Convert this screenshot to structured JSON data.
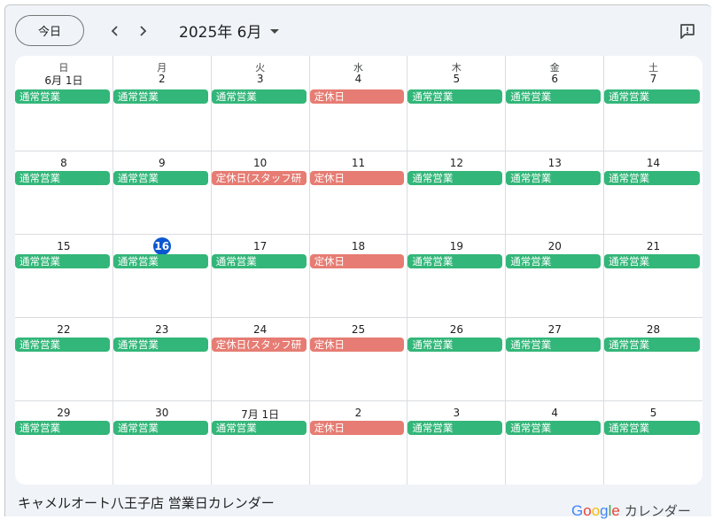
{
  "toolbar": {
    "today_label": "今日",
    "month_title": "2025年 6月",
    "prev_icon": "chevron-left-icon",
    "next_icon": "chevron-right-icon",
    "dropdown_icon": "arrow-drop-down-icon",
    "feedback_icon": "feedback-icon"
  },
  "weekdays": [
    "日",
    "月",
    "火",
    "水",
    "木",
    "金",
    "土"
  ],
  "event_colors": {
    "open": "#33b679",
    "closed": "#e67c73"
  },
  "weeks": [
    [
      {
        "date": "6月 1日",
        "event": "通常営業",
        "type": "open"
      },
      {
        "date": "2",
        "event": "通常営業",
        "type": "open"
      },
      {
        "date": "3",
        "event": "通常営業",
        "type": "open"
      },
      {
        "date": "4",
        "event": "定休日",
        "type": "closed"
      },
      {
        "date": "5",
        "event": "通常営業",
        "type": "open"
      },
      {
        "date": "6",
        "event": "通常営業",
        "type": "open"
      },
      {
        "date": "7",
        "event": "通常営業",
        "type": "open"
      }
    ],
    [
      {
        "date": "8",
        "event": "通常営業",
        "type": "open"
      },
      {
        "date": "9",
        "event": "通常営業",
        "type": "open"
      },
      {
        "date": "10",
        "event": "定休日(スタッフ研",
        "type": "closed"
      },
      {
        "date": "11",
        "event": "定休日",
        "type": "closed"
      },
      {
        "date": "12",
        "event": "通常営業",
        "type": "open"
      },
      {
        "date": "13",
        "event": "通常営業",
        "type": "open"
      },
      {
        "date": "14",
        "event": "通常営業",
        "type": "open"
      }
    ],
    [
      {
        "date": "15",
        "event": "通常営業",
        "type": "open"
      },
      {
        "date": "16",
        "event": "通常営業",
        "type": "open",
        "today": true
      },
      {
        "date": "17",
        "event": "通常営業",
        "type": "open"
      },
      {
        "date": "18",
        "event": "定休日",
        "type": "closed"
      },
      {
        "date": "19",
        "event": "通常営業",
        "type": "open"
      },
      {
        "date": "20",
        "event": "通常営業",
        "type": "open"
      },
      {
        "date": "21",
        "event": "通常営業",
        "type": "open"
      }
    ],
    [
      {
        "date": "22",
        "event": "通常営業",
        "type": "open"
      },
      {
        "date": "23",
        "event": "通常営業",
        "type": "open"
      },
      {
        "date": "24",
        "event": "定休日(スタッフ研",
        "type": "closed"
      },
      {
        "date": "25",
        "event": "定休日",
        "type": "closed"
      },
      {
        "date": "26",
        "event": "通常営業",
        "type": "open"
      },
      {
        "date": "27",
        "event": "通常営業",
        "type": "open"
      },
      {
        "date": "28",
        "event": "通常営業",
        "type": "open"
      }
    ],
    [
      {
        "date": "29",
        "event": "通常営業",
        "type": "open"
      },
      {
        "date": "30",
        "event": "通常営業",
        "type": "open"
      },
      {
        "date": "7月 1日",
        "event": "通常営業",
        "type": "open"
      },
      {
        "date": "2",
        "event": "定休日",
        "type": "closed"
      },
      {
        "date": "3",
        "event": "通常営業",
        "type": "open"
      },
      {
        "date": "4",
        "event": "通常営業",
        "type": "open"
      },
      {
        "date": "5",
        "event": "通常営業",
        "type": "open"
      }
    ]
  ],
  "footer": {
    "calendar_title": "キャメルオート八王子店 営業日カレンダー",
    "google_logo": "Google",
    "brand_label": "カレンダー"
  }
}
